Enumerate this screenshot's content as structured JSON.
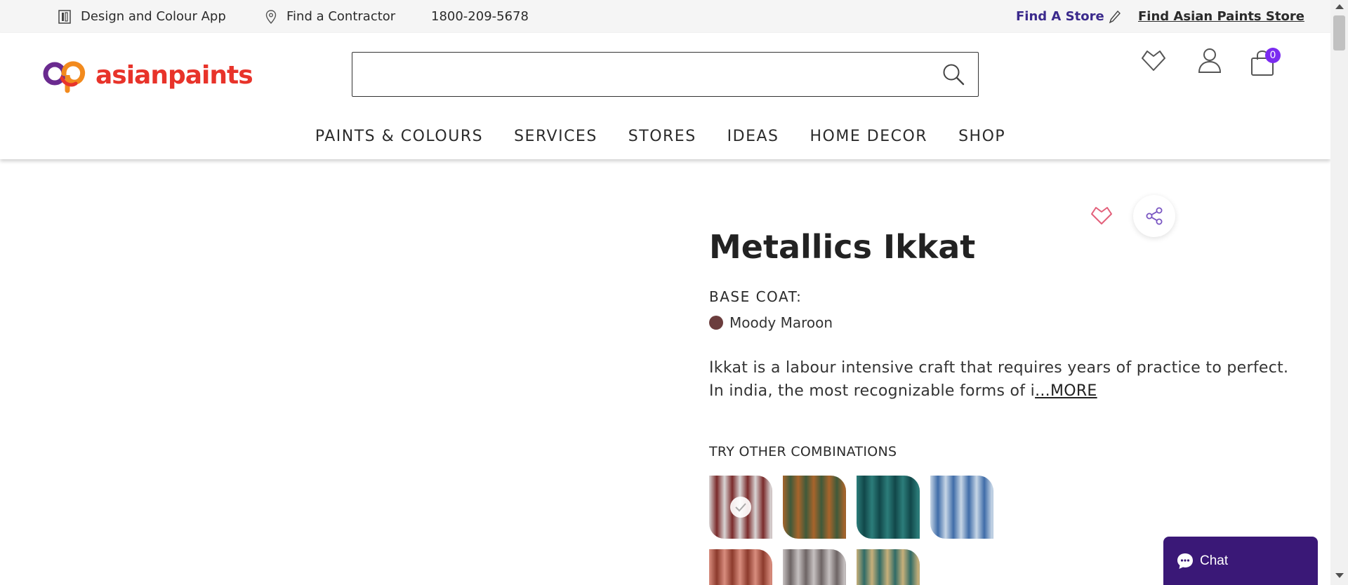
{
  "topbar": {
    "design_app": "Design and Colour App",
    "find_contractor": "Find a Contractor",
    "phone": "1800-209-5678",
    "find_store": "Find A Store",
    "find_ap_store": "Find Asian Paints Store"
  },
  "header": {
    "logo_text": "asianpaints",
    "search_placeholder": "",
    "cart_count": "0",
    "nav": [
      "PAINTS & COLOURS",
      "SERVICES",
      "STORES",
      "IDEAS",
      "HOME DECOR",
      "SHOP"
    ]
  },
  "product": {
    "title": "Metallics Ikkat",
    "base_coat_label": "BASE COAT:",
    "base_coat_name": "Moody Maroon",
    "base_coat_color": "#6b3d3d",
    "description": "Ikkat is a labour intensive craft that requires years of practice to perfect. In india, the most recognizable forms of i",
    "more_label": "...MORE",
    "combos_label": "TRY OTHER COMBINATIONS"
  },
  "combinations": [
    {
      "name": "maroon-silver",
      "colors": [
        "#d9d5d5",
        "#7a2a2a"
      ],
      "selected": true
    },
    {
      "name": "brown-green",
      "colors": [
        "#a8642b",
        "#3f5a3a"
      ],
      "selected": false
    },
    {
      "name": "teal-dark",
      "colors": [
        "#2c7d7a",
        "#11484a"
      ],
      "selected": false
    },
    {
      "name": "blue-silver",
      "colors": [
        "#c7d6e6",
        "#3f6ca8"
      ],
      "selected": false
    },
    {
      "name": "terracotta",
      "colors": [
        "#d88d7e",
        "#8c3a2c"
      ],
      "selected": false
    },
    {
      "name": "grey-silver",
      "colors": [
        "#c6c1c1",
        "#6d6464"
      ],
      "selected": false
    },
    {
      "name": "sand-teal",
      "colors": [
        "#c8b07a",
        "#2f6b66"
      ],
      "selected": false
    }
  ],
  "chat": {
    "label": "Chat"
  },
  "colors": {
    "brand_red": "#e8332a",
    "accent_purple": "#3a1877",
    "badge": "#7b2cf0"
  }
}
